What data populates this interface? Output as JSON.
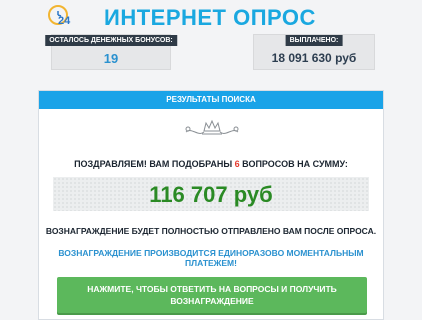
{
  "header": {
    "logo_number": "24",
    "title": "ИНТЕРНЕТ ОПРОС"
  },
  "stats": {
    "bonuses_label": "ОСТАЛОСЬ ДЕНЕЖНЫХ БОНУСОВ:",
    "bonuses_value": "19",
    "paid_label": "ВЫПЛАЧЕНО:",
    "paid_value": "18 091 630 руб"
  },
  "panel": {
    "header": "РЕЗУЛЬТАТЫ ПОИСКА",
    "congrats_prefix": "ПОЗДРАВЛЯЕМ! ВАМ ПОДОБРАНЫ ",
    "congrats_count": "6",
    "congrats_suffix": " ВОПРОСОВ НА СУММУ:",
    "amount": "116 707 руб",
    "sent_note": "ВОЗНАГРАЖДЕНИЕ БУДЕТ ПОЛНОСТЬЮ ОТПРАВЛЕНО ВАМ ПОСЛЕ ОПРОСА.",
    "once_note": "ВОЗНАГРАЖДЕНИЕ ПРОИЗВОДИТСЯ ЕДИНОРАЗОВО МОМЕНТАЛЬНЫМ ПЛАТЕЖЕМ!",
    "cta_line1": "НАЖМИТЕ, ЧТОБЫ ОТВЕТИТЬ НА ВОПРОСЫ И ПОЛУЧИТЬ",
    "cta_line2": "ВОЗНАГРАЖДЕНИЕ"
  },
  "colors": {
    "title": "#1aa8e0",
    "panel_header": "#1aa3e8",
    "amount": "#2a8a24",
    "accent_count": "#e53b2f",
    "cta": "#5cb85c"
  },
  "icons": {
    "logo": "clock-icon",
    "ornament": "crown-ornament-icon"
  }
}
